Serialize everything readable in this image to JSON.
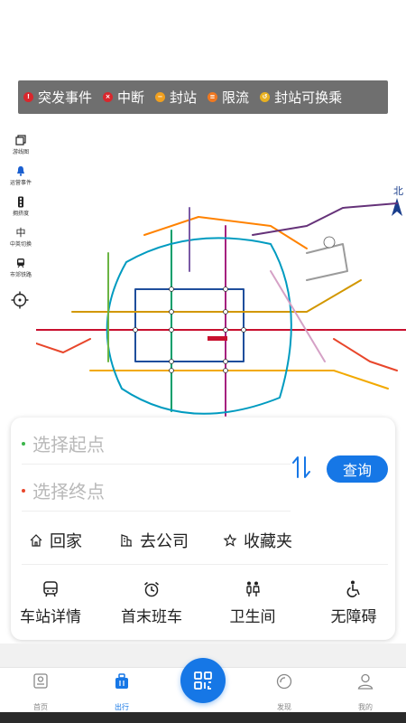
{
  "colors": {
    "accent": "#1677e6",
    "incident": "#d9262c",
    "interrupt": "#d9262c",
    "closed": "#f0a020",
    "limit": "#f07820",
    "transfer": "#e8b020",
    "start_dot": "#3bb54a",
    "end_dot": "#e8462b"
  },
  "legend": {
    "items": [
      {
        "label": "突发事件",
        "icon": "exclamation-icon"
      },
      {
        "label": "中断",
        "icon": "cross-icon"
      },
      {
        "label": "封站",
        "icon": "minus-icon"
      },
      {
        "label": "限流",
        "icon": "limit-icon"
      },
      {
        "label": "封站可换乘",
        "icon": "transfer-icon"
      }
    ]
  },
  "tools": [
    {
      "label": "游线图",
      "icon": "copy-icon"
    },
    {
      "label": "运营事件",
      "icon": "bell-icon"
    },
    {
      "label": "拥挤度",
      "icon": "traffic-light-icon"
    },
    {
      "label": "中英切换",
      "icon": "language-icon",
      "glyph": "中"
    },
    {
      "label": "市郊铁路",
      "icon": "train-icon"
    }
  ],
  "compass": {
    "label": "北"
  },
  "search": {
    "start_placeholder": "选择起点",
    "end_placeholder": "选择终点",
    "query_label": "查询"
  },
  "quick_links": [
    {
      "label": "回家",
      "icon": "home-icon"
    },
    {
      "label": "去公司",
      "icon": "building-icon"
    },
    {
      "label": "收藏夹",
      "icon": "star-icon"
    }
  ],
  "services": [
    {
      "label": "车站详情",
      "icon": "bus-icon"
    },
    {
      "label": "首末班车",
      "icon": "alarm-clock-icon"
    },
    {
      "label": "卫生间",
      "icon": "restroom-icon"
    },
    {
      "label": "无障碍",
      "icon": "wheelchair-icon"
    }
  ],
  "nav": [
    {
      "label": "首页",
      "icon": "home-screen-icon"
    },
    {
      "label": "出行",
      "icon": "briefcase-icon",
      "active": true
    },
    {
      "label": "发现",
      "icon": "discover-icon"
    },
    {
      "label": "我的",
      "icon": "profile-icon"
    }
  ]
}
